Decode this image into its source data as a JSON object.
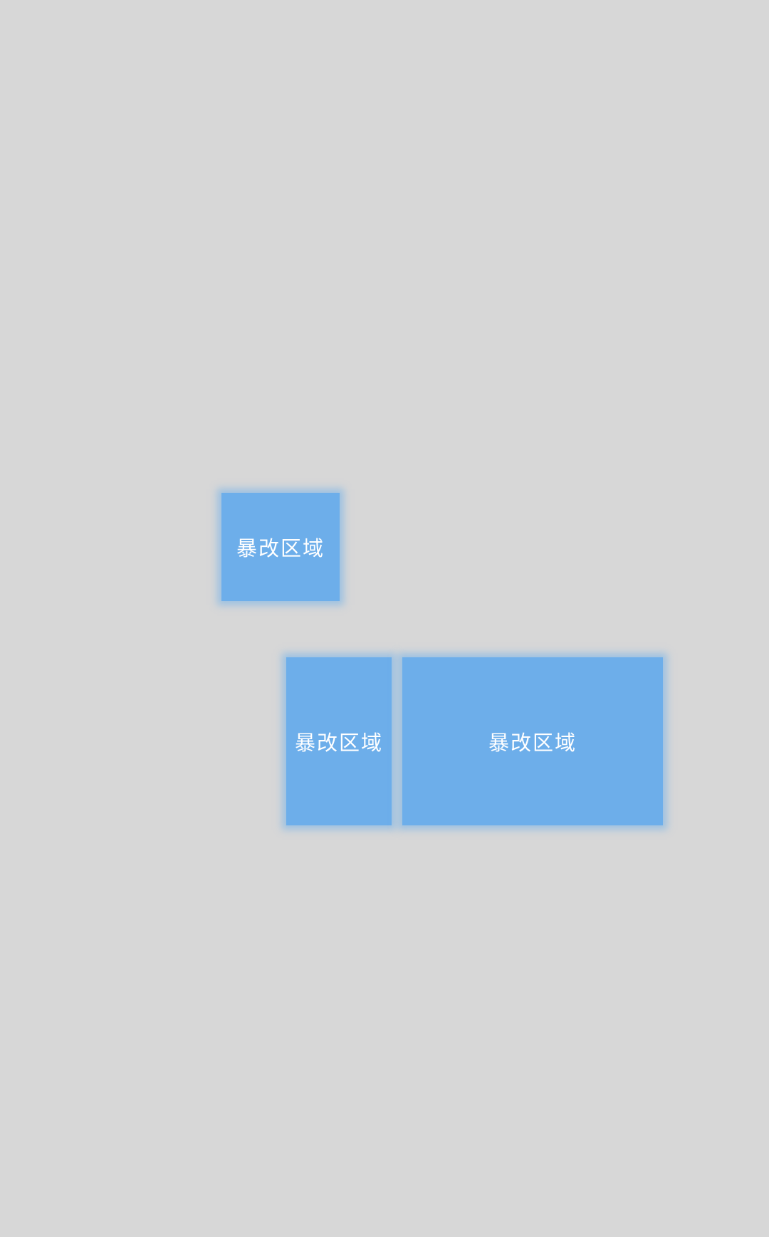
{
  "redacted_regions": [
    {
      "label": "暴改区域"
    },
    {
      "label": "暴改区域"
    },
    {
      "label": "暴改区域"
    }
  ]
}
